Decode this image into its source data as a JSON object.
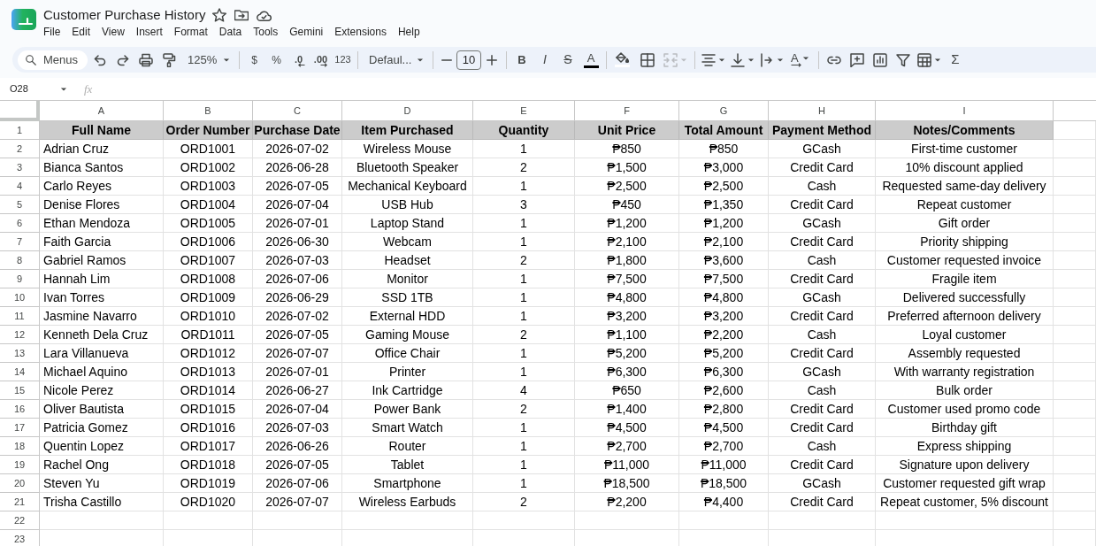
{
  "document": {
    "title": "Customer Purchase History"
  },
  "menu": [
    "File",
    "Edit",
    "View",
    "Insert",
    "Format",
    "Data",
    "Tools",
    "Gemini",
    "Extensions",
    "Help"
  ],
  "toolbar": {
    "search_label": "Menus",
    "zoom": "125%",
    "currency": "$",
    "percent": "%",
    "decrease_decimal": ".0",
    "increase_decimal": ".00",
    "number_formats": "123",
    "font": "Defaul...",
    "font_size": "10",
    "bold": "B",
    "italic": "I",
    "strikethrough": "S",
    "text_color": "A",
    "text_rotation": "A",
    "sum": "Σ",
    "merge_disabled": true
  },
  "formula_bar": {
    "cell_ref": "O28",
    "fx_label": "fx"
  },
  "sheet": {
    "columns": [
      "A",
      "B",
      "C",
      "D",
      "E",
      "F",
      "G",
      "H",
      "I"
    ],
    "header_row": {
      "number": "1",
      "cells": [
        "Full Name",
        "Order Number",
        "Purchase Date",
        "Item Purchased",
        "Quantity",
        "Unit Price",
        "Total Amount",
        "Payment Method",
        "Notes/Comments"
      ]
    },
    "rows": [
      {
        "number": "2",
        "cells": [
          "Adrian Cruz",
          "ORD1001",
          "2026-07-02",
          "Wireless Mouse",
          "1",
          "₱850",
          "₱850",
          "GCash",
          "First-time customer"
        ]
      },
      {
        "number": "3",
        "cells": [
          "Bianca Santos",
          "ORD1002",
          "2026-06-28",
          "Bluetooth Speaker",
          "2",
          "₱1,500",
          "₱3,000",
          "Credit Card",
          "10% discount applied"
        ]
      },
      {
        "number": "4",
        "cells": [
          "Carlo Reyes",
          "ORD1003",
          "2026-07-05",
          "Mechanical Keyboard",
          "1",
          "₱2,500",
          "₱2,500",
          "Cash",
          "Requested same-day delivery"
        ]
      },
      {
        "number": "5",
        "cells": [
          "Denise Flores",
          "ORD1004",
          "2026-07-04",
          "USB Hub",
          "3",
          "₱450",
          "₱1,350",
          "Credit Card",
          "Repeat customer"
        ]
      },
      {
        "number": "6",
        "cells": [
          "Ethan Mendoza",
          "ORD1005",
          "2026-07-01",
          "Laptop Stand",
          "1",
          "₱1,200",
          "₱1,200",
          "GCash",
          "Gift order"
        ]
      },
      {
        "number": "7",
        "cells": [
          "Faith Garcia",
          "ORD1006",
          "2026-06-30",
          "Webcam",
          "1",
          "₱2,100",
          "₱2,100",
          "Credit Card",
          "Priority shipping"
        ]
      },
      {
        "number": "8",
        "cells": [
          "Gabriel Ramos",
          "ORD1007",
          "2026-07-03",
          "Headset",
          "2",
          "₱1,800",
          "₱3,600",
          "Cash",
          "Customer requested invoice"
        ]
      },
      {
        "number": "9",
        "cells": [
          "Hannah Lim",
          "ORD1008",
          "2026-07-06",
          "Monitor",
          "1",
          "₱7,500",
          "₱7,500",
          "Credit Card",
          "Fragile item"
        ]
      },
      {
        "number": "10",
        "cells": [
          "Ivan Torres",
          "ORD1009",
          "2026-06-29",
          "SSD 1TB",
          "1",
          "₱4,800",
          "₱4,800",
          "GCash",
          "Delivered successfully"
        ]
      },
      {
        "number": "11",
        "cells": [
          "Jasmine Navarro",
          "ORD1010",
          "2026-07-02",
          "External HDD",
          "1",
          "₱3,200",
          "₱3,200",
          "Credit Card",
          "Preferred afternoon delivery"
        ]
      },
      {
        "number": "12",
        "cells": [
          "Kenneth Dela Cruz",
          "ORD1011",
          "2026-07-05",
          "Gaming Mouse",
          "2",
          "₱1,100",
          "₱2,200",
          "Cash",
          "Loyal customer"
        ]
      },
      {
        "number": "13",
        "cells": [
          "Lara Villanueva",
          "ORD1012",
          "2026-07-07",
          "Office Chair",
          "1",
          "₱5,200",
          "₱5,200",
          "Credit Card",
          "Assembly requested"
        ]
      },
      {
        "number": "14",
        "cells": [
          "Michael Aquino",
          "ORD1013",
          "2026-07-01",
          "Printer",
          "1",
          "₱6,300",
          "₱6,300",
          "GCash",
          "With warranty registration"
        ]
      },
      {
        "number": "15",
        "cells": [
          "Nicole Perez",
          "ORD1014",
          "2026-06-27",
          "Ink Cartridge",
          "4",
          "₱650",
          "₱2,600",
          "Cash",
          "Bulk order"
        ]
      },
      {
        "number": "16",
        "cells": [
          "Oliver Bautista",
          "ORD1015",
          "2026-07-04",
          "Power Bank",
          "2",
          "₱1,400",
          "₱2,800",
          "Credit Card",
          "Customer used promo code"
        ]
      },
      {
        "number": "17",
        "cells": [
          "Patricia Gomez",
          "ORD1016",
          "2026-07-03",
          "Smart Watch",
          "1",
          "₱4,500",
          "₱4,500",
          "Credit Card",
          "Birthday gift"
        ]
      },
      {
        "number": "18",
        "cells": [
          "Quentin Lopez",
          "ORD1017",
          "2026-06-26",
          "Router",
          "1",
          "₱2,700",
          "₱2,700",
          "Cash",
          "Express shipping"
        ]
      },
      {
        "number": "19",
        "cells": [
          "Rachel Ong",
          "ORD1018",
          "2026-07-05",
          "Tablet",
          "1",
          "₱11,000",
          "₱11,000",
          "Credit Card",
          "Signature upon delivery"
        ]
      },
      {
        "number": "20",
        "cells": [
          "Steven Yu",
          "ORD1019",
          "2026-07-06",
          "Smartphone",
          "1",
          "₱18,500",
          "₱18,500",
          "GCash",
          "Customer requested gift wrap"
        ]
      },
      {
        "number": "21",
        "cells": [
          "Trisha Castillo",
          "ORD1020",
          "2026-07-07",
          "Wireless Earbuds",
          "2",
          "₱2,200",
          "₱4,400",
          "Credit Card",
          "Repeat customer, 5% discount"
        ]
      },
      {
        "number": "22"
      },
      {
        "number": "23"
      }
    ]
  }
}
